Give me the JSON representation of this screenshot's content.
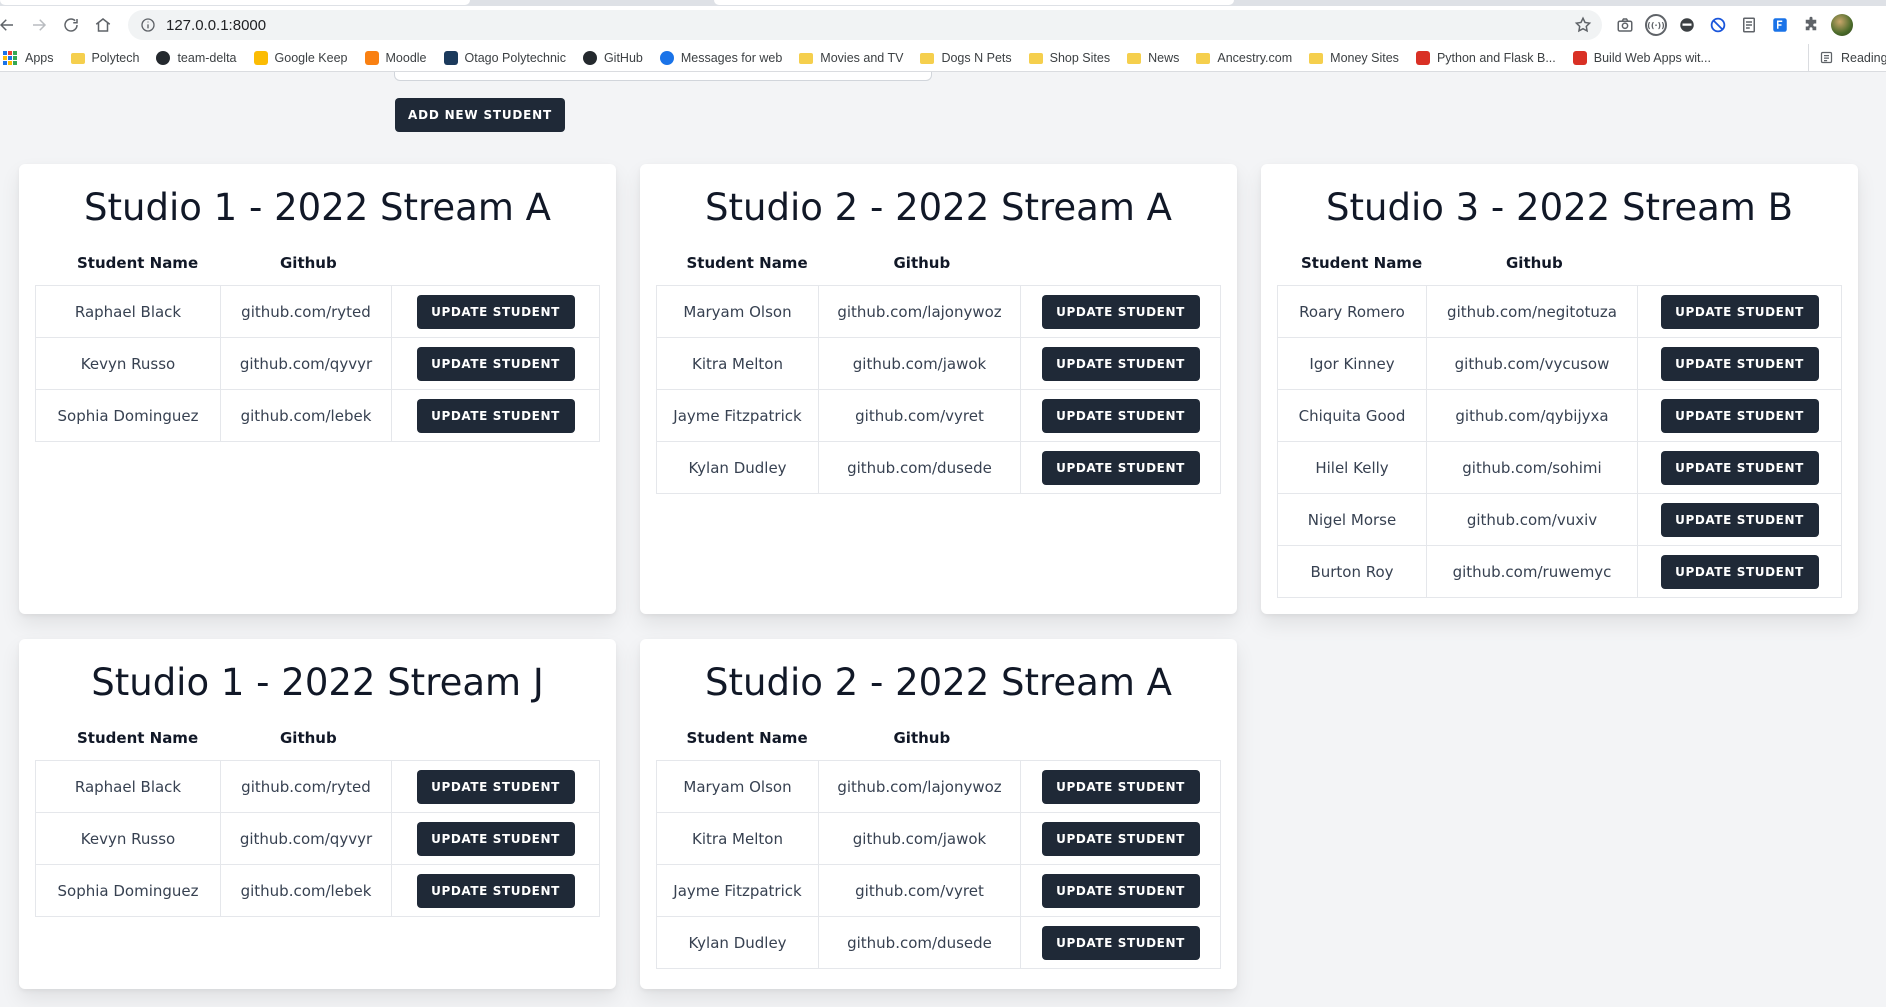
{
  "browser": {
    "url": "127.0.0.1:8000",
    "bookmarks": [
      {
        "label": "Apps",
        "icon": "apps-grid-icon"
      },
      {
        "label": "Polytech",
        "icon": "folder-icon"
      },
      {
        "label": "team-delta",
        "icon": "github-icon"
      },
      {
        "label": "Google Keep",
        "icon": "keep-icon"
      },
      {
        "label": "Moodle",
        "icon": "moodle-icon"
      },
      {
        "label": "Otago Polytechnic",
        "icon": "otago-icon"
      },
      {
        "label": "GitHub",
        "icon": "github-icon"
      },
      {
        "label": "Messages for web",
        "icon": "messages-icon"
      },
      {
        "label": "Movies and TV",
        "icon": "folder-icon"
      },
      {
        "label": "Dogs N Pets",
        "icon": "folder-icon"
      },
      {
        "label": "Shop Sites",
        "icon": "folder-icon"
      },
      {
        "label": "News",
        "icon": "folder-icon"
      },
      {
        "label": "Ancestry.com",
        "icon": "folder-icon"
      },
      {
        "label": "Money Sites",
        "icon": "folder-icon"
      },
      {
        "label": "Python and Flask B...",
        "icon": "flask-icon"
      },
      {
        "label": "Build Web Apps wit...",
        "icon": "flask-icon"
      }
    ],
    "reading_list": "Reading list"
  },
  "page": {
    "add_button_label": "ADD NEW STUDENT",
    "update_label": "UPDATE STUDENT",
    "col_name": "Student Name",
    "col_github": "Github",
    "accent_color": "#1f2937",
    "studios": [
      {
        "title": "Studio 1 - 2022 Stream A",
        "students": [
          {
            "name": "Raphael Black",
            "github": "github.com/ryted"
          },
          {
            "name": "Kevyn Russo",
            "github": "github.com/qyvyr"
          },
          {
            "name": "Sophia Dominguez",
            "github": "github.com/lebek"
          }
        ]
      },
      {
        "title": "Studio 2 - 2022 Stream A",
        "students": [
          {
            "name": "Maryam Olson",
            "github": "github.com/lajonywoz"
          },
          {
            "name": "Kitra Melton",
            "github": "github.com/jawok"
          },
          {
            "name": "Jayme Fitzpatrick",
            "github": "github.com/vyret"
          },
          {
            "name": "Kylan Dudley",
            "github": "github.com/dusede"
          }
        ]
      },
      {
        "title": "Studio 3 - 2022 Stream B",
        "students": [
          {
            "name": "Roary Romero",
            "github": "github.com/negitotuza"
          },
          {
            "name": "Igor Kinney",
            "github": "github.com/vycusow"
          },
          {
            "name": "Chiquita Good",
            "github": "github.com/qybijyxa"
          },
          {
            "name": "Hilel Kelly",
            "github": "github.com/sohimi"
          },
          {
            "name": "Nigel Morse",
            "github": "github.com/vuxiv"
          },
          {
            "name": "Burton Roy",
            "github": "github.com/ruwemyc"
          }
        ]
      },
      {
        "title": "Studio 1 - 2022 Stream J",
        "students": [
          {
            "name": "Raphael Black",
            "github": "github.com/ryted"
          },
          {
            "name": "Kevyn Russo",
            "github": "github.com/qyvyr"
          },
          {
            "name": "Sophia Dominguez",
            "github": "github.com/lebek"
          }
        ]
      },
      {
        "title": "Studio 2 - 2022 Stream A",
        "students": [
          {
            "name": "Maryam Olson",
            "github": "github.com/lajonywoz"
          },
          {
            "name": "Kitra Melton",
            "github": "github.com/jawok"
          },
          {
            "name": "Jayme Fitzpatrick",
            "github": "github.com/vyret"
          },
          {
            "name": "Kylan Dudley",
            "github": "github.com/dusede"
          }
        ]
      }
    ]
  }
}
